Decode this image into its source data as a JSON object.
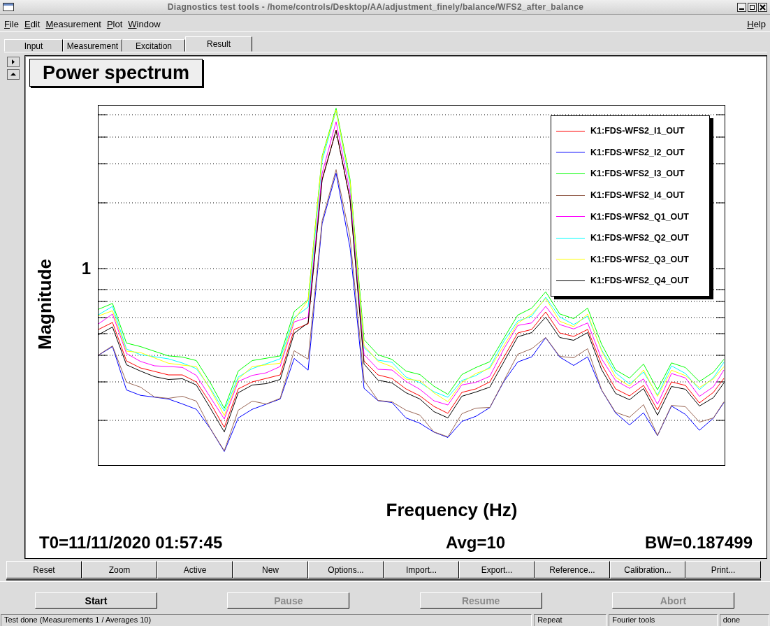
{
  "window": {
    "title": "Diagnostics test tools - /home/controls/Desktop/AA/adjustment_finely/balance/WFS2_after_balance"
  },
  "menu": [
    {
      "label": "File"
    },
    {
      "label": "Edit"
    },
    {
      "label": "Measurement"
    },
    {
      "label": "Plot"
    },
    {
      "label": "Window"
    }
  ],
  "help_menu": {
    "label": "Help"
  },
  "tabs": [
    {
      "label": "Input",
      "selected": false
    },
    {
      "label": "Measurement",
      "selected": false
    },
    {
      "label": "Excitation",
      "selected": false
    },
    {
      "label": "Result",
      "selected": true
    }
  ],
  "plot": {
    "title": "Power spectrum",
    "ylabel": "Magnitude",
    "xlabel": "Frequency (Hz)",
    "ytick": "1",
    "legend": [
      {
        "label": "K1:FDS-WFS2_I1_OUT",
        "color": "#ff0000"
      },
      {
        "label": "K1:FDS-WFS2_I2_OUT",
        "color": "#0000ff"
      },
      {
        "label": "K1:FDS-WFS2_I3_OUT",
        "color": "#00ff00"
      },
      {
        "label": "K1:FDS-WFS2_I4_OUT",
        "color": "#996655"
      },
      {
        "label": "K1:FDS-WFS2_Q1_OUT",
        "color": "#ff00ff"
      },
      {
        "label": "K1:FDS-WFS2_Q2_OUT",
        "color": "#00ffff"
      },
      {
        "label": "K1:FDS-WFS2_Q3_OUT",
        "color": "#ffff00"
      },
      {
        "label": "K1:FDS-WFS2_Q4_OUT",
        "color": "#000000"
      }
    ],
    "t0": "T0=11/11/2020 01:57:45",
    "avg": "Avg=10",
    "bw": "BW=0.187499"
  },
  "plot_buttons": [
    {
      "label": "Reset"
    },
    {
      "label": "Zoom"
    },
    {
      "label": "Active"
    },
    {
      "label": "New"
    },
    {
      "label": "Options..."
    },
    {
      "label": "Import..."
    },
    {
      "label": "Export..."
    },
    {
      "label": "Reference..."
    },
    {
      "label": "Calibration..."
    },
    {
      "label": "Print..."
    }
  ],
  "run_buttons": [
    {
      "label": "Start",
      "disabled": false
    },
    {
      "label": "Pause",
      "disabled": true
    },
    {
      "label": "Resume",
      "disabled": true
    },
    {
      "label": "Abort",
      "disabled": true
    }
  ],
  "status_bar": [
    {
      "text": "Test done (Measurements 1 / Averages 10)"
    },
    {
      "text": "Repeat"
    },
    {
      "text": "Fourier tools"
    },
    {
      "text": "done"
    }
  ]
}
